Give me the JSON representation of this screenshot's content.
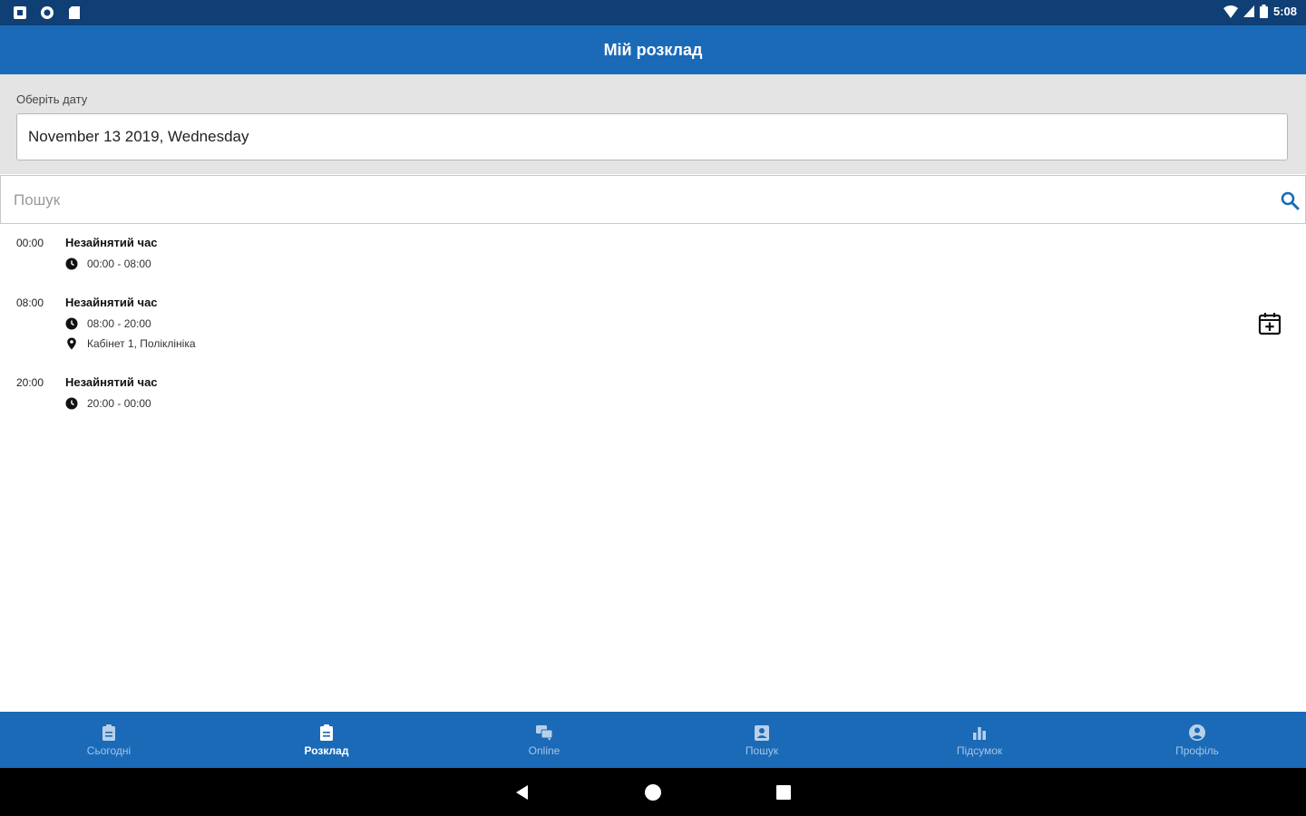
{
  "status_bar": {
    "time": "5:08",
    "icons_left": [
      "app-notification-icon",
      "sync-icon",
      "sd-card-icon"
    ],
    "icons_right": [
      "wifi-icon",
      "cell-signal-icon",
      "battery-icon"
    ]
  },
  "app_bar": {
    "title": "Мій розклад"
  },
  "date_picker": {
    "label": "Оберіть дату",
    "value": "November 13 2019, Wednesday"
  },
  "search": {
    "placeholder": "Пошук",
    "icon": "search-icon"
  },
  "schedule": [
    {
      "start": "00:00",
      "title": "Незайнятий час",
      "range": "00:00 - 08:00"
    },
    {
      "start": "08:00",
      "title": "Незайнятий час",
      "range": "08:00 - 20:00",
      "location": "Кабінет 1, Поліклініка"
    },
    {
      "start": "20:00",
      "title": "Незайнятий час",
      "range": "20:00 - 00:00"
    }
  ],
  "bottom_nav": [
    {
      "label": "Сьогодні",
      "icon": "clipboard-icon",
      "active": false
    },
    {
      "label": "Розклад",
      "icon": "clipboard-icon",
      "active": true
    },
    {
      "label": "Online",
      "icon": "chat-icon",
      "active": false
    },
    {
      "label": "Пошук",
      "icon": "person-card-icon",
      "active": false
    },
    {
      "label": "Підсумок",
      "icon": "bar-chart-icon",
      "active": false
    },
    {
      "label": "Профіль",
      "icon": "account-circle-icon",
      "active": false
    }
  ],
  "colors": {
    "status_bar": "#0f3f74",
    "primary": "#1a6ab8",
    "date_section_bg": "#e4e4e4",
    "search_icon": "#1a6ab8"
  }
}
